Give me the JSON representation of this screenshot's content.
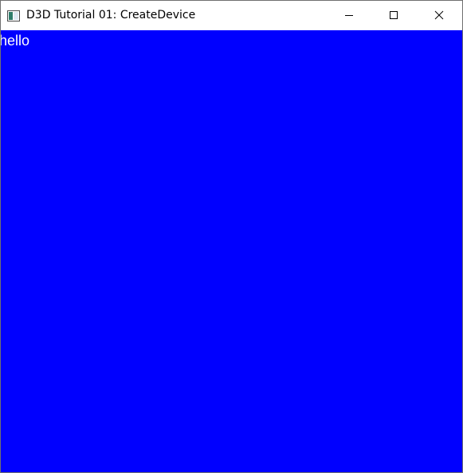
{
  "window": {
    "title": "D3D Tutorial 01: CreateDevice",
    "icon": "app-window-icon",
    "controls": {
      "minimize": "minimize-icon",
      "maximize": "maximize-icon",
      "close": "close-icon"
    }
  },
  "client": {
    "background_color": "#0000ff",
    "text": "hello",
    "text_color": "#ffffff"
  }
}
